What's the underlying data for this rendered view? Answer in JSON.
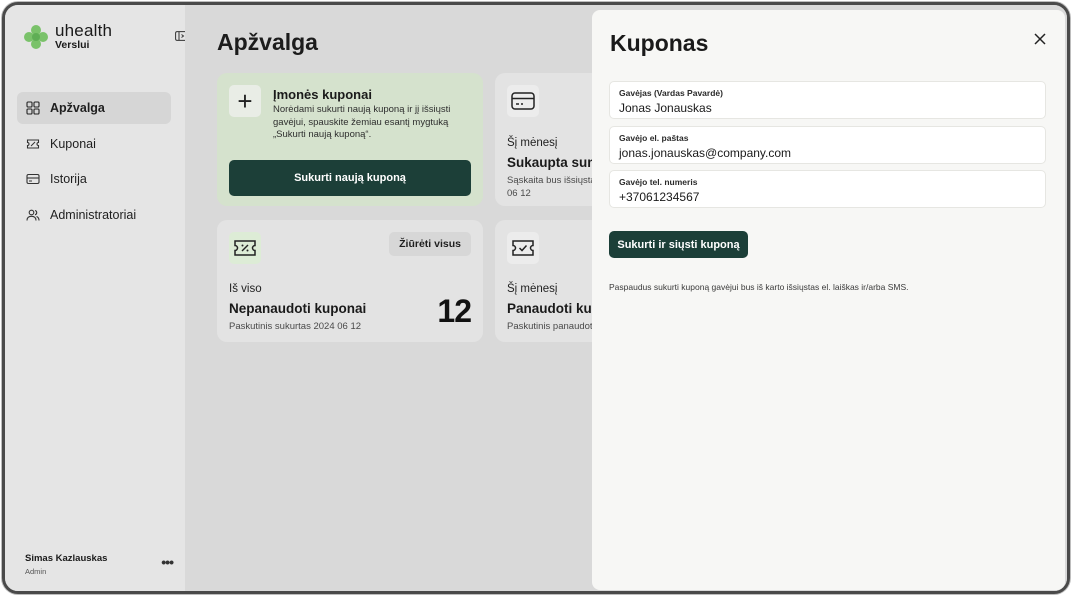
{
  "brand": {
    "name": "uhealth",
    "sub": "Verslui"
  },
  "sidebar": {
    "items": [
      {
        "label": "Apžvalga",
        "icon": "grid-icon",
        "active": true
      },
      {
        "label": "Kuponai",
        "icon": "ticket-icon",
        "active": false
      },
      {
        "label": "Istorija",
        "icon": "card-icon",
        "active": false
      },
      {
        "label": "Administratoriai",
        "icon": "users-icon",
        "active": false
      }
    ],
    "user": {
      "name": "Simas Kazlauskas",
      "role": "Admin",
      "more": "•••"
    }
  },
  "main": {
    "title": "Apžvalga",
    "promo": {
      "title": "Įmonės kuponai",
      "text": "Norėdami sukurti naują kuponą ir jį išsiųsti gavėjui, spauskite žemiau esantį mygtuką „Sukurti naują kuponą“.",
      "button": "Sukurti naują kuponą",
      "icon": "+"
    },
    "sum_card": {
      "label": "Šį mėnesį",
      "title": "Sukaupta suma",
      "sub_line1": "Sąskaita bus išsiųsta",
      "sub_line2": "06 12"
    },
    "unused_card": {
      "view_all": "Žiūrėti visus",
      "label": "Iš viso",
      "title": "Nepanaudoti kuponai",
      "sub": "Paskutinis sukurtas 2024 06 12",
      "count": "12"
    },
    "used_card": {
      "label": "Šį mėnesį",
      "title": "Panaudoti kuponai",
      "sub": "Paskutinis panaudotas"
    }
  },
  "drawer": {
    "title": "Kuponas",
    "fields": [
      {
        "label": "Gavėjas (Vardas Pavardė)",
        "value": "Jonas Jonauskas"
      },
      {
        "label": "Gavėjo el. paštas",
        "value": "jonas.jonauskas@company.com"
      },
      {
        "label": "Gavėjo tel. numeris",
        "value": "+37061234567"
      }
    ],
    "submit": "Sukurti ir siųsti kuponą",
    "note": "Paspaudus sukurti kuponą gavėjui bus iš karto išsiųstas el. laiškas ir/arba SMS."
  },
  "colors": {
    "primary": "#1c3f38",
    "promo_bg": "#d5e2cd",
    "brand_green": "#7ac26a"
  }
}
